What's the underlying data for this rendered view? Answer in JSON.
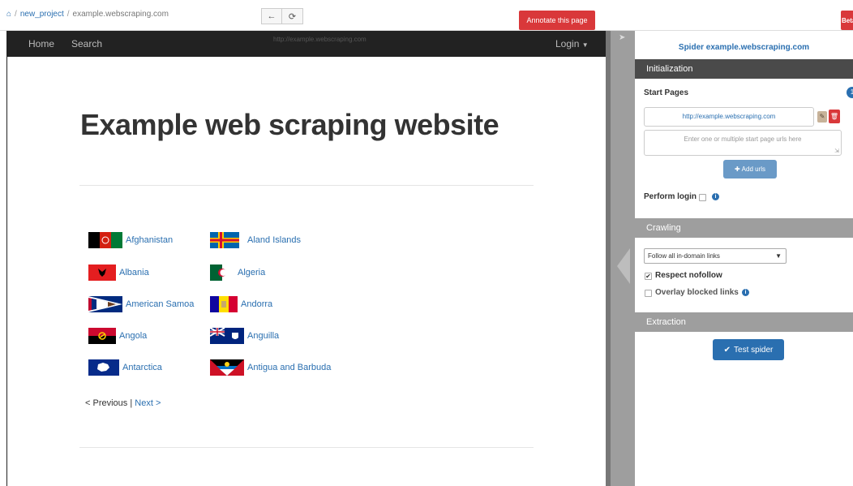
{
  "topbar": {
    "breadcrumb": {
      "project": "new_project",
      "separator": "/",
      "current": "example.webscraping.com"
    },
    "back_icon": "←",
    "reload_icon": "⟳",
    "annotate_label": "Annotate this page",
    "beta_label": "Beta"
  },
  "site": {
    "nav_home": "Home",
    "nav_search": "Search",
    "nav_url": "http://example.webscraping.com",
    "nav_login": "Login",
    "title": "Example web scraping website",
    "countries": [
      {
        "name": "Afghanistan",
        "flag": "afghanistan-flag"
      },
      {
        "name": "Aland Islands",
        "flag": "aland-islands-flag"
      },
      {
        "name": "Albania",
        "flag": "albania-flag"
      },
      {
        "name": "Algeria",
        "flag": "algeria-flag"
      },
      {
        "name": "American Samoa",
        "flag": "american-samoa-flag"
      },
      {
        "name": "Andorra",
        "flag": "andorra-flag"
      },
      {
        "name": "Angola",
        "flag": "angola-flag"
      },
      {
        "name": "Anguilla",
        "flag": "anguilla-flag"
      },
      {
        "name": "Antarctica",
        "flag": "antarctica-flag"
      },
      {
        "name": "Antigua and Barbuda",
        "flag": "antigua-and-barbuda-flag"
      }
    ],
    "pager_prev": "< Previous",
    "pager_sep": "|",
    "pager_next": "Next >"
  },
  "panel": {
    "title": "Spider example.webscraping.com",
    "initialization_header": "Initialization",
    "start_pages_label": "Start Pages",
    "start_pages_count": "1",
    "start_url": "http://example.webscraping.com",
    "urls_placeholder": "Enter one or multiple start page urls here",
    "add_urls_label": "Add urls",
    "perform_login_label": "Perform login",
    "crawling_header": "Crawling",
    "crawl_option": "Follow all in-domain links",
    "respect_nofollow_label": "Respect nofollow",
    "respect_nofollow_checked": true,
    "overlay_blocked_label": "Overlay blocked links",
    "overlay_blocked_checked": false,
    "extraction_header": "Extraction",
    "test_spider_label": "Test spider"
  },
  "colors": {
    "link": "#2a6fb0",
    "danger": "#d9383a",
    "navbar": "#222222",
    "section_dark": "#4a4a4a",
    "section_gray": "#9e9e9e"
  }
}
